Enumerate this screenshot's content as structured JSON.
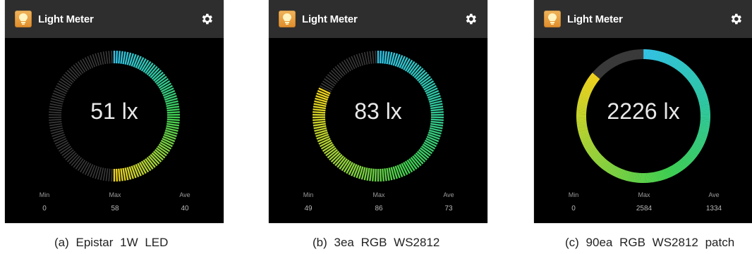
{
  "panels": [
    {
      "app_title": "Light Meter",
      "reading": "51 lx",
      "stats": [
        {
          "label": "Min",
          "value": "0"
        },
        {
          "label": "Max",
          "value": "58"
        },
        {
          "label": "Ave",
          "value": "40"
        }
      ],
      "gauge_style": "ticks",
      "level_fraction": 0.5,
      "caption": "(a) Epistar 1W LED"
    },
    {
      "app_title": "Light Meter",
      "reading": "83 lx",
      "stats": [
        {
          "label": "Min",
          "value": "49"
        },
        {
          "label": "Max",
          "value": "86"
        },
        {
          "label": "Ave",
          "value": "73"
        }
      ],
      "gauge_style": "ticks",
      "level_fraction": 0.82,
      "caption": "(b) 3ea RGB WS2812"
    },
    {
      "app_title": "Light Meter",
      "reading": "2226 lx",
      "stats": [
        {
          "label": "Min",
          "value": "0"
        },
        {
          "label": "Max",
          "value": "2584"
        },
        {
          "label": "Ave",
          "value": "1334"
        }
      ],
      "gauge_style": "solid",
      "level_fraction": 0.86,
      "caption": "(c) 90ea RGB WS2812 patch"
    }
  ],
  "colors": {
    "screen_bg": "#000000",
    "appbar_bg": "#2e2e2e",
    "app_icon": "#e8a040",
    "gauge_track": "#3a3a3a",
    "gradient": [
      "#33c3e6",
      "#2fc7a2",
      "#3fcf52",
      "#9ad23a",
      "#f0d21e"
    ]
  },
  "icons": {
    "app": "lightbulb-icon",
    "settings": "gear-icon"
  }
}
